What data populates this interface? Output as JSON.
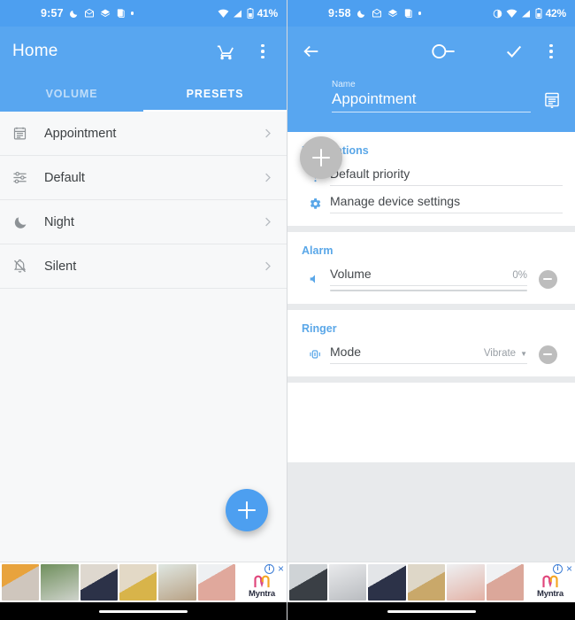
{
  "left": {
    "status": {
      "time": "9:57",
      "battery": "41%",
      "icons": [
        "moon-icon",
        "mail-icon",
        "layers-icon",
        "copy-icon",
        "dot-icon"
      ],
      "right_icons": [
        "wifi-icon",
        "signal-icon",
        "battery-icon"
      ]
    },
    "appbar": {
      "title": "Home",
      "cart_icon": "cart-icon",
      "overflow_icon": "overflow-menu-icon"
    },
    "tabs": [
      {
        "label": "VOLUME",
        "active": false
      },
      {
        "label": "PRESETS",
        "active": true
      }
    ],
    "presets": [
      {
        "label": "Appointment",
        "icon": "calendar-icon"
      },
      {
        "label": "Default",
        "icon": "tune-icon"
      },
      {
        "label": "Night",
        "icon": "moon-icon"
      },
      {
        "label": "Silent",
        "icon": "bell-off-icon"
      }
    ],
    "fab": {
      "icon": "plus-icon"
    }
  },
  "right": {
    "status": {
      "time": "9:58",
      "battery": "42%",
      "icons": [
        "moon-icon",
        "mail-icon",
        "layers-icon",
        "copy-icon",
        "dot-icon"
      ],
      "right_icons": [
        "contrast-icon",
        "wifi-icon",
        "signal-icon",
        "battery-icon"
      ]
    },
    "appbar": {
      "back_icon": "back-arrow-icon",
      "toggle_icon": "toggle-switch-icon",
      "confirm_icon": "check-icon",
      "overflow_icon": "overflow-menu-icon"
    },
    "name": {
      "label": "Name",
      "value": "Appointment",
      "trailing_icon": "calendar-icon"
    },
    "fab": {
      "icon": "plus-icon"
    },
    "sections": [
      {
        "title": "Notifications",
        "rows": [
          {
            "icon": "priority-icon",
            "label": "Default priority",
            "value": "",
            "has_caret": false,
            "has_remove": false,
            "has_slider": false
          },
          {
            "icon": "gear-icon",
            "label": "Manage device settings",
            "value": "",
            "has_caret": false,
            "has_remove": false,
            "has_slider": false
          }
        ]
      },
      {
        "title": "Alarm",
        "rows": [
          {
            "icon": "volume-icon",
            "label": "Volume",
            "value": "0%",
            "has_caret": false,
            "has_remove": true,
            "has_slider": true
          }
        ]
      },
      {
        "title": "Ringer",
        "rows": [
          {
            "icon": "vibrate-icon",
            "label": "Mode",
            "value": "Vibrate",
            "has_caret": true,
            "has_remove": true,
            "has_slider": false
          }
        ]
      }
    ]
  },
  "ad": {
    "info_label": "i",
    "close_label": "×",
    "brand": "Myntra",
    "thumb_colors": [
      "#c9b79e",
      "#7d8f6b",
      "#d7d2cc",
      "#e2cf9a",
      "#cfe0dc",
      "#e8d3cd"
    ]
  },
  "colors": {
    "primary": "#58a6f0",
    "status_bar": "#4d9ff0",
    "accent": "#5aa7e8",
    "fab": "#4d9ff0"
  }
}
